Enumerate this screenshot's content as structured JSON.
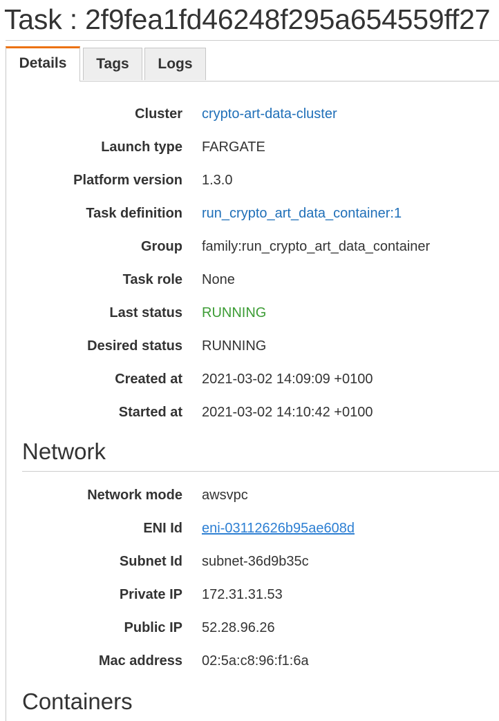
{
  "title": "Task : 2f9fea1fd46248f295a654559ff27",
  "tabs": [
    {
      "label": "Details",
      "active": true
    },
    {
      "label": "Tags",
      "active": false
    },
    {
      "label": "Logs",
      "active": false
    }
  ],
  "details": {
    "cluster": {
      "label": "Cluster",
      "value": "crypto-art-data-cluster"
    },
    "launch_type": {
      "label": "Launch type",
      "value": "FARGATE"
    },
    "platform_version": {
      "label": "Platform version",
      "value": "1.3.0"
    },
    "task_definition": {
      "label": "Task definition",
      "value": "run_crypto_art_data_container:1"
    },
    "group": {
      "label": "Group",
      "value": "family:run_crypto_art_data_container"
    },
    "task_role": {
      "label": "Task role",
      "value": "None"
    },
    "last_status": {
      "label": "Last status",
      "value": "RUNNING"
    },
    "desired_status": {
      "label": "Desired status",
      "value": "RUNNING"
    },
    "created_at": {
      "label": "Created at",
      "value": "2021-03-02 14:09:09 +0100"
    },
    "started_at": {
      "label": "Started at",
      "value": "2021-03-02 14:10:42 +0100"
    }
  },
  "network": {
    "heading": "Network",
    "network_mode": {
      "label": "Network mode",
      "value": "awsvpc"
    },
    "eni_id": {
      "label": "ENI Id",
      "value": "eni-03112626b95ae608d"
    },
    "subnet_id": {
      "label": "Subnet Id",
      "value": "subnet-36d9b35c"
    },
    "private_ip": {
      "label": "Private IP",
      "value": "172.31.31.53"
    },
    "public_ip": {
      "label": "Public IP",
      "value": "52.28.96.26"
    },
    "mac_address": {
      "label": "Mac address",
      "value": "02:5a:c8:96:f1:6a"
    }
  },
  "containers": {
    "heading": "Containers"
  },
  "colors": {
    "link": "#1f6fb8",
    "status_running": "#3c9c35",
    "active_tab_accent": "#ec7211"
  }
}
